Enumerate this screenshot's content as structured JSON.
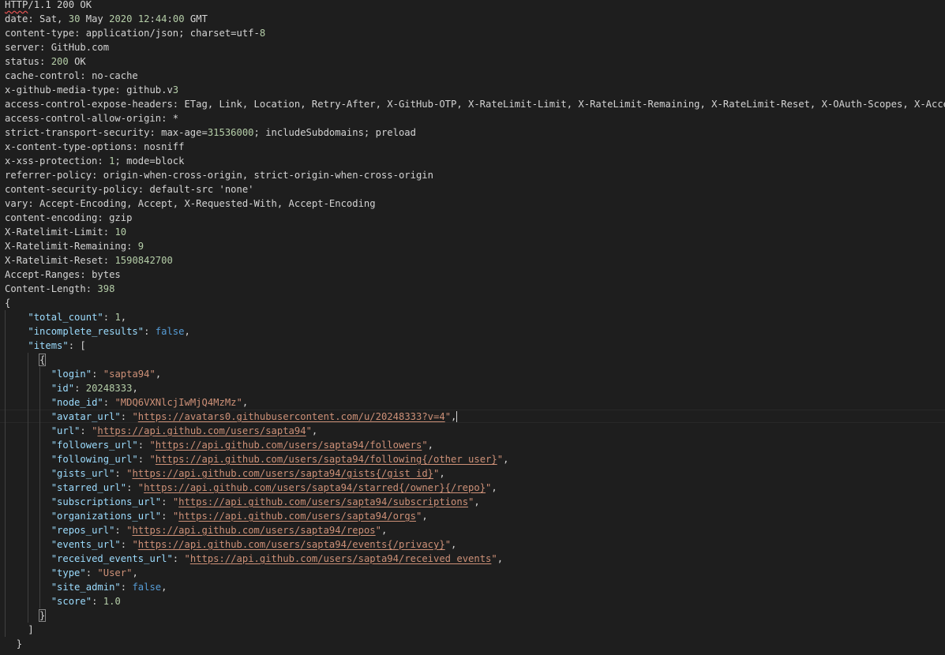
{
  "headers": {
    "status_line": {
      "protocol": "HTTP",
      "rest": "/1.1 200 OK"
    },
    "lines": [
      [
        "date",
        ": Sat, ",
        "30",
        " May ",
        "2020",
        " ",
        "12",
        ":",
        "44",
        ":",
        "00",
        " GMT"
      ],
      [
        "content-type",
        ": application/json; charset=utf-",
        "8"
      ],
      [
        "server",
        ": GitHub.com"
      ],
      [
        "status",
        ": ",
        "200",
        " OK"
      ],
      [
        "cache-control",
        ": no-cache"
      ],
      [
        "x-github-media-type",
        ": github.v",
        "3"
      ],
      [
        "access-control-expose-headers",
        ": ETag, Link, Location, Retry-After, X-GitHub-OTP, X-RateLimit-Limit, X-RateLimit-Remaining, X-RateLimit-Reset, X-OAuth-Scopes, X-Accept"
      ],
      [
        "access-control-allow-origin",
        ": *"
      ],
      [
        "strict-transport-security",
        ": max-age=",
        "31536000",
        "; includeSubdomains; preload"
      ],
      [
        "x-content-type-options",
        ": nosniff"
      ],
      [
        "x-xss-protection",
        ": ",
        "1",
        "; mode=block"
      ],
      [
        "referrer-policy",
        ": origin-when-cross-origin, strict-origin-when-cross-origin"
      ],
      [
        "content-security-policy",
        ": default-src 'none'"
      ],
      [
        "vary",
        ": Accept-Encoding, Accept, X-Requested-With, Accept-Encoding"
      ],
      [
        "content-encoding",
        ": gzip"
      ],
      [
        "X-Ratelimit-Limit",
        ": ",
        "10"
      ],
      [
        "X-Ratelimit-Remaining",
        ": ",
        "9"
      ],
      [
        "X-Ratelimit-Reset",
        ": ",
        "1590842700"
      ],
      [
        "Accept-Ranges",
        ": bytes"
      ],
      [
        "Content-Length",
        ": ",
        "398"
      ]
    ]
  },
  "body": {
    "open_brace": "{",
    "close_brace": "}",
    "total_count": {
      "key": "\"total_count\"",
      "value": "1"
    },
    "incomplete_results": {
      "key": "\"incomplete_results\"",
      "value": "false"
    },
    "items": {
      "key": "\"items\"",
      "open": "[",
      "close": "]",
      "item_open": "{",
      "item_close": "}",
      "fields": [
        {
          "key": "\"login\"",
          "value": "\"sapta94\"",
          "kind": "str"
        },
        {
          "key": "\"id\"",
          "value": "20248333",
          "kind": "num"
        },
        {
          "key": "\"node_id\"",
          "value": "\"MDQ6VXNlcjIwMjQ4MzMz\"",
          "kind": "str"
        },
        {
          "key": "\"avatar_url\"",
          "value": "https://avatars0.githubusercontent.com/u/20248333?v=4",
          "kind": "url",
          "cursor": true
        },
        {
          "key": "\"url\"",
          "value": "https://api.github.com/users/sapta94",
          "kind": "url"
        },
        {
          "key": "\"followers_url\"",
          "value": "https://api.github.com/users/sapta94/followers",
          "kind": "url"
        },
        {
          "key": "\"following_url\"",
          "value": "https://api.github.com/users/sapta94/following{/other_user}",
          "kind": "url"
        },
        {
          "key": "\"gists_url\"",
          "value": "https://api.github.com/users/sapta94/gists{/gist_id}",
          "kind": "url"
        },
        {
          "key": "\"starred_url\"",
          "value": "https://api.github.com/users/sapta94/starred{/owner}{/repo}",
          "kind": "url"
        },
        {
          "key": "\"subscriptions_url\"",
          "value": "https://api.github.com/users/sapta94/subscriptions",
          "kind": "url"
        },
        {
          "key": "\"organizations_url\"",
          "value": "https://api.github.com/users/sapta94/orgs",
          "kind": "url"
        },
        {
          "key": "\"repos_url\"",
          "value": "https://api.github.com/users/sapta94/repos",
          "kind": "url"
        },
        {
          "key": "\"events_url\"",
          "value": "https://api.github.com/users/sapta94/events{/privacy}",
          "kind": "url"
        },
        {
          "key": "\"received_events_url\"",
          "value": "https://api.github.com/users/sapta94/received_events",
          "kind": "url"
        },
        {
          "key": "\"type\"",
          "value": "\"User\"",
          "kind": "str"
        },
        {
          "key": "\"site_admin\"",
          "value": "false",
          "kind": "kw"
        },
        {
          "key": "\"score\"",
          "value": "1.0",
          "kind": "num",
          "last": true
        }
      ]
    }
  }
}
